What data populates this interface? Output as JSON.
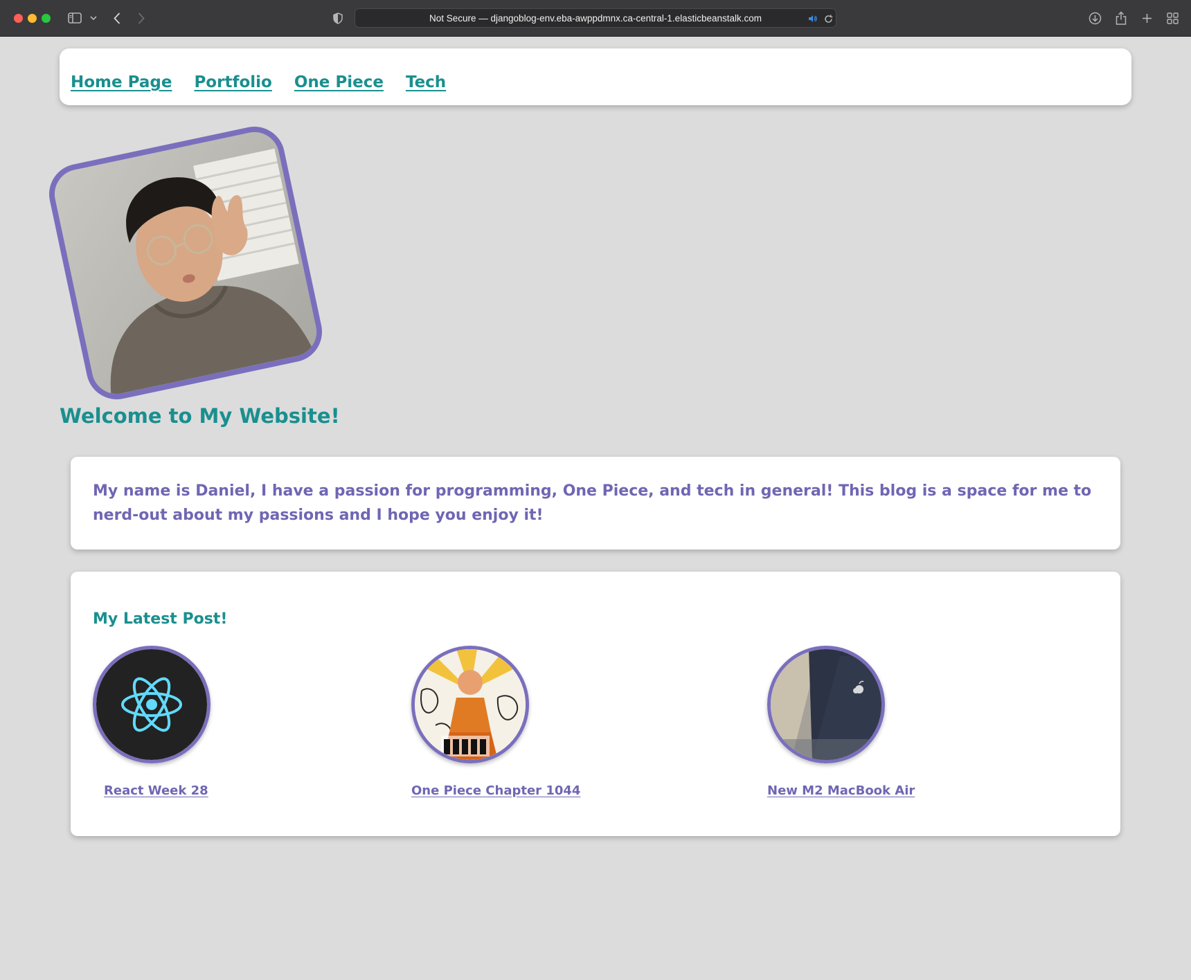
{
  "browser": {
    "url_text": "Not Secure — djangoblog-env.eba-awppdmnx.ca-central-1.elasticbeanstalk.com",
    "icons": [
      "sidebar-icon",
      "chevron-down-icon",
      "back-icon",
      "forward-icon",
      "shield-icon",
      "speaker-icon",
      "reload-icon",
      "download-icon",
      "share-icon",
      "new-tab-icon",
      "tab-overview-icon"
    ]
  },
  "nav": {
    "links": [
      {
        "label": "Home Page"
      },
      {
        "label": "Portfolio"
      },
      {
        "label": "One Piece"
      },
      {
        "label": "Tech"
      }
    ]
  },
  "hero": {
    "welcome": "Welcome to My Website!"
  },
  "about": {
    "text": "My name is Daniel, I have a passion for programming, One Piece, and tech in general! This blog is a space for me to nerd-out about my passions and I hope you enjoy it!"
  },
  "latest": {
    "title": "My Latest Post!",
    "posts": [
      {
        "title": "React Week 28"
      },
      {
        "title": "One Piece Chapter 1044"
      },
      {
        "title": "New M2 MacBook Air"
      }
    ]
  },
  "colors": {
    "teal": "#1a8f8f",
    "purple": "#7a6fbd",
    "text_purple": "#6f66b3",
    "page_bg": "#dcdcdc"
  }
}
